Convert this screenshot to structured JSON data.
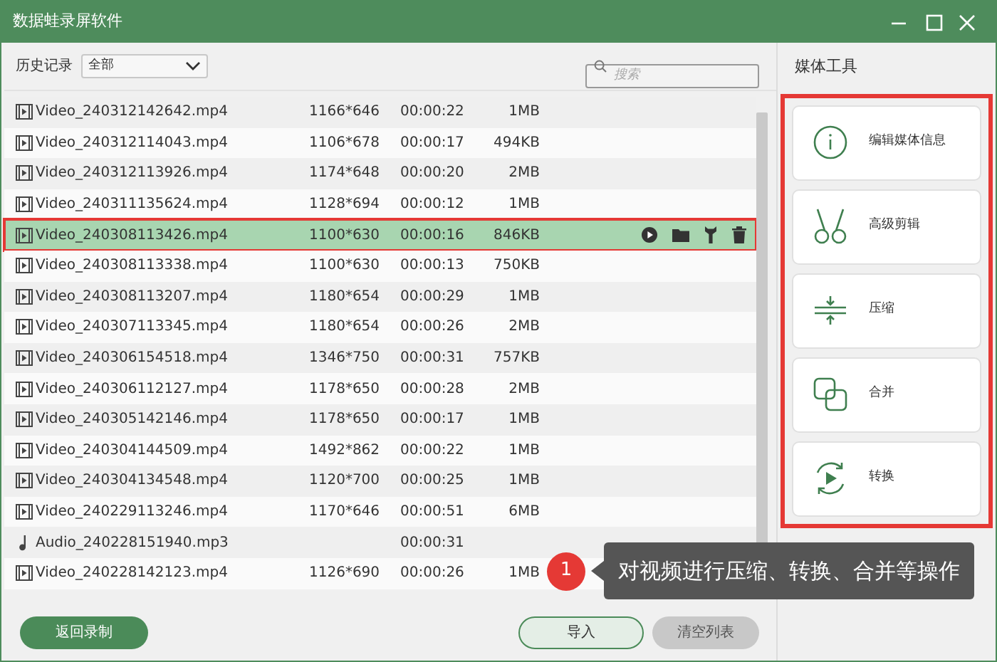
{
  "window": {
    "title": "数据蛙录屏软件"
  },
  "toolbar": {
    "history_label": "历史记录",
    "filter": "全部",
    "search": {
      "placeholder": "搜索"
    }
  },
  "files": [
    {
      "kind": "video",
      "name": "Video_240312142642.mp4",
      "resolution": "1166*646",
      "duration": "00:00:22",
      "size": "1MB",
      "selected": false
    },
    {
      "kind": "video",
      "name": "Video_240312114043.mp4",
      "resolution": "1106*678",
      "duration": "00:00:17",
      "size": "494KB",
      "selected": false
    },
    {
      "kind": "video",
      "name": "Video_240312113926.mp4",
      "resolution": "1174*648",
      "duration": "00:00:20",
      "size": "2MB",
      "selected": false
    },
    {
      "kind": "video",
      "name": "Video_240311135624.mp4",
      "resolution": "1128*694",
      "duration": "00:00:12",
      "size": "1MB",
      "selected": false
    },
    {
      "kind": "video",
      "name": "Video_240308113426.mp4",
      "resolution": "1100*630",
      "duration": "00:00:16",
      "size": "846KB",
      "selected": true
    },
    {
      "kind": "video",
      "name": "Video_240308113338.mp4",
      "resolution": "1100*630",
      "duration": "00:00:13",
      "size": "750KB",
      "selected": false
    },
    {
      "kind": "video",
      "name": "Video_240308113207.mp4",
      "resolution": "1180*654",
      "duration": "00:00:29",
      "size": "1MB",
      "selected": false
    },
    {
      "kind": "video",
      "name": "Video_240307113345.mp4",
      "resolution": "1180*654",
      "duration": "00:00:26",
      "size": "2MB",
      "selected": false
    },
    {
      "kind": "video",
      "name": "Video_240306154518.mp4",
      "resolution": "1346*750",
      "duration": "00:00:31",
      "size": "757KB",
      "selected": false
    },
    {
      "kind": "video",
      "name": "Video_240306112127.mp4",
      "resolution": "1178*650",
      "duration": "00:00:28",
      "size": "2MB",
      "selected": false
    },
    {
      "kind": "video",
      "name": "Video_240305142146.mp4",
      "resolution": "1178*650",
      "duration": "00:00:17",
      "size": "1MB",
      "selected": false
    },
    {
      "kind": "video",
      "name": "Video_240304144509.mp4",
      "resolution": "1492*862",
      "duration": "00:00:22",
      "size": "1MB",
      "selected": false
    },
    {
      "kind": "video",
      "name": "Video_240304134548.mp4",
      "resolution": "1120*700",
      "duration": "00:00:25",
      "size": "1MB",
      "selected": false
    },
    {
      "kind": "video",
      "name": "Video_240229113246.mp4",
      "resolution": "1170*646",
      "duration": "00:00:51",
      "size": "6MB",
      "selected": false
    },
    {
      "kind": "audio",
      "name": "Audio_240228151940.mp3",
      "duration": "00:00:31",
      "selected": false
    },
    {
      "kind": "video",
      "name": "Video_240228142123.mp4",
      "resolution": "1126*690",
      "duration": "00:00:26",
      "size": "1MB",
      "selected": false
    }
  ],
  "media_tools": {
    "title": "媒体工具",
    "tools": [
      {
        "kind": "info",
        "label": "编辑媒体信息"
      },
      {
        "kind": "cut",
        "label": "高级剪辑"
      },
      {
        "kind": "compress",
        "label": "压缩"
      },
      {
        "kind": "merge",
        "label": "合并"
      },
      {
        "kind": "convert",
        "label": "转换"
      }
    ]
  },
  "callout": {
    "number": "1",
    "text": "对视频进行压缩、转换、合并等操作"
  },
  "buttons": {
    "back": "返回录制",
    "import": "导入",
    "clear": "清空列表"
  }
}
